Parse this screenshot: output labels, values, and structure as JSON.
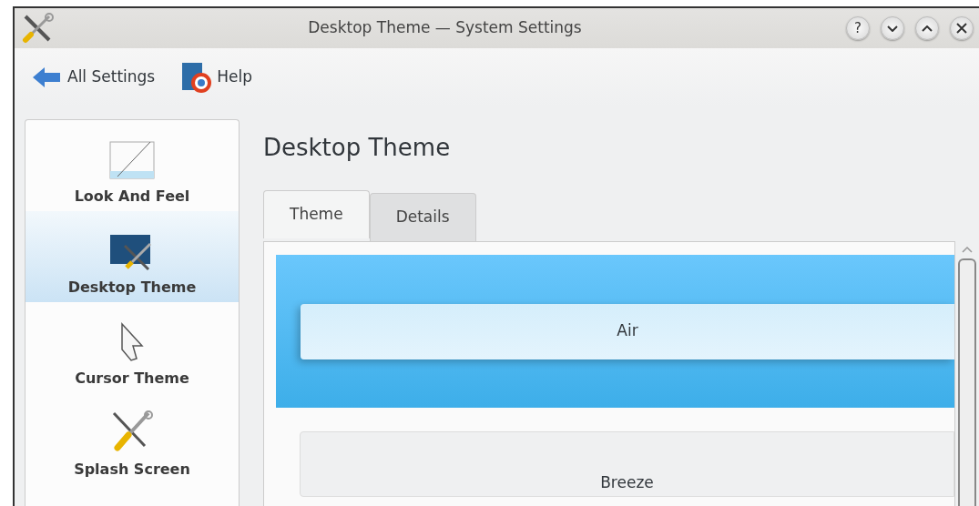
{
  "window": {
    "title": "Desktop Theme — System Settings",
    "buttons": [
      {
        "kind": "help",
        "label": "?"
      },
      {
        "kind": "minimize"
      },
      {
        "kind": "maximize"
      },
      {
        "kind": "close"
      }
    ]
  },
  "toolbar": [
    {
      "kind": "back",
      "label": "All Settings"
    },
    {
      "kind": "help",
      "label": "Help"
    }
  ],
  "sidebar": {
    "items": [
      {
        "kind": "look",
        "label": "Look And Feel",
        "selected": false
      },
      {
        "kind": "desktop",
        "label": "Desktop Theme",
        "selected": true
      },
      {
        "kind": "cursor",
        "label": "Cursor Theme",
        "selected": false
      },
      {
        "kind": "splash",
        "label": "Splash Screen",
        "selected": false
      }
    ]
  },
  "page": {
    "heading": "Desktop Theme",
    "tabs": [
      {
        "label": "Theme",
        "selected": true
      },
      {
        "label": "Details",
        "selected": false
      }
    ],
    "themes": [
      {
        "name": "Air",
        "selected": true
      },
      {
        "name": "Breeze",
        "selected": false
      }
    ]
  }
}
